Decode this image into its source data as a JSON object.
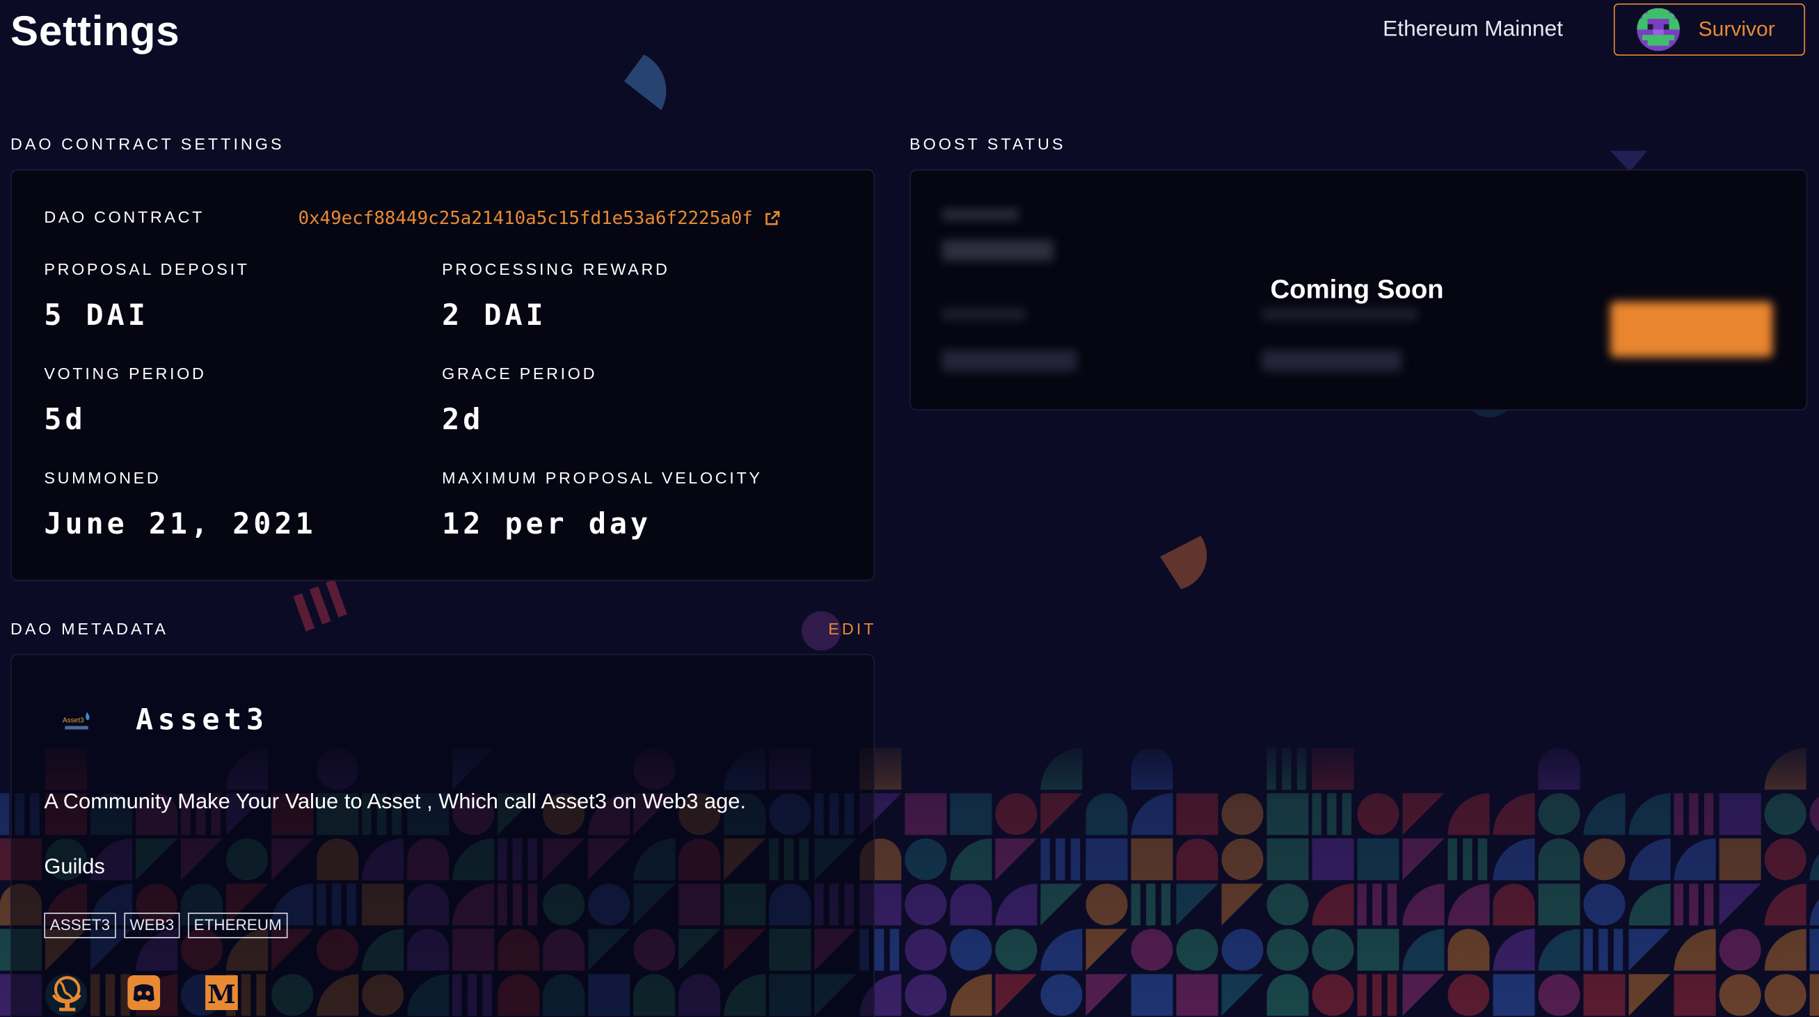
{
  "header": {
    "title": "Settings",
    "network": "Ethereum Mainnet",
    "account_name": "Survivor"
  },
  "contract_settings": {
    "section_label": "DAO CONTRACT SETTINGS",
    "dao_contract_label": "DAO CONTRACT",
    "dao_contract_address": "0x49ecf88449c25a21410a5c15fd1e53a6f2225a0f",
    "fields": [
      {
        "label": "PROPOSAL DEPOSIT",
        "value": "5 DAI"
      },
      {
        "label": "PROCESSING REWARD",
        "value": "2 DAI"
      },
      {
        "label": "VOTING PERIOD",
        "value": "5d"
      },
      {
        "label": "GRACE PERIOD",
        "value": "2d"
      },
      {
        "label": "SUMMONED",
        "value": "June 21, 2021"
      },
      {
        "label": "MAXIMUM PROPOSAL VELOCITY",
        "value": "12 per day"
      }
    ]
  },
  "boost_status": {
    "section_label": "BOOST STATUS",
    "overlay_text": "Coming Soon"
  },
  "metadata": {
    "section_label": "DAO METADATA",
    "edit_label": "EDIT",
    "logo_text": "Asset3",
    "name": "Asset3",
    "description": "A Community Make Your Value to Asset , Which call Asset3 on Web3 age.",
    "purpose": "Guilds",
    "tags": [
      "ASSET3",
      "WEB3",
      "ETHEREUM"
    ],
    "links": [
      "website-icon",
      "discord-icon",
      "medium-icon"
    ]
  },
  "colors": {
    "accent": "#e88a32",
    "background": "#0b0b26",
    "card": "#060612"
  }
}
